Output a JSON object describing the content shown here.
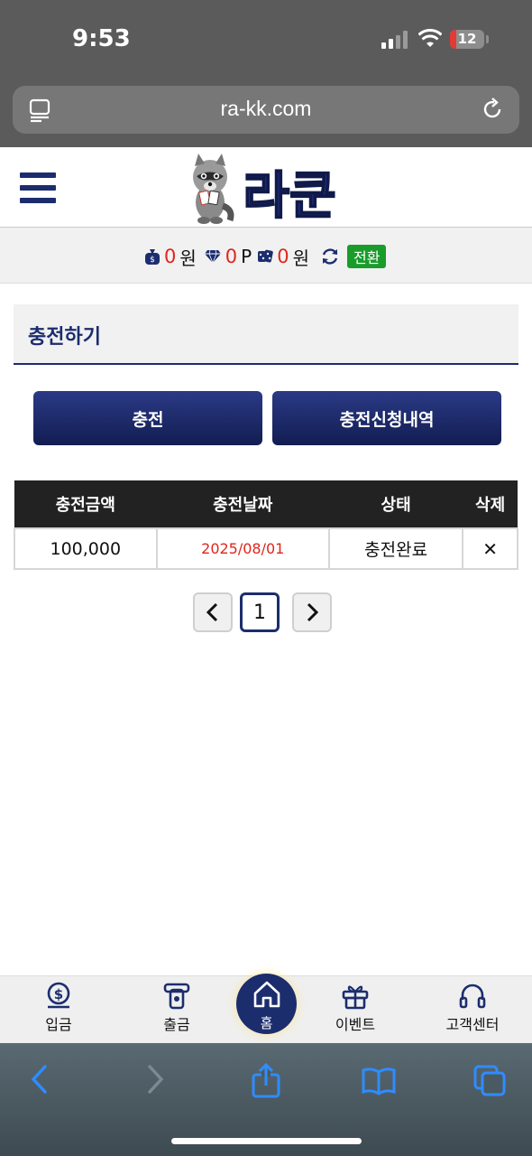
{
  "status_bar": {
    "time": "9:53",
    "battery": "12"
  },
  "browser": {
    "url": "ra-kk.com"
  },
  "site": {
    "logo_text": "라쿤"
  },
  "balance": {
    "money": "0",
    "money_unit": "원",
    "point": "0",
    "point_unit": "P",
    "casino": "0",
    "casino_unit": "원",
    "swap_label": "전환"
  },
  "page_title": "충전하기",
  "buttons": {
    "charge": "충전",
    "history": "충전신청내역"
  },
  "table": {
    "headers": [
      "충전금액",
      "충전날짜",
      "상태",
      "삭제"
    ],
    "rows": [
      {
        "amount": "100,000",
        "date": "2025/08/01",
        "status": "충전완료",
        "delete": "✕"
      }
    ]
  },
  "pagination": {
    "prev": "‹",
    "current": "1",
    "next": "›"
  },
  "bottom_nav": {
    "deposit": "입금",
    "withdraw": "출금",
    "home": "홈",
    "event": "이벤트",
    "support": "고객센터"
  },
  "colors": {
    "navy": "#1c2d6e",
    "red": "#e0251c",
    "green": "#1a9c2b"
  }
}
